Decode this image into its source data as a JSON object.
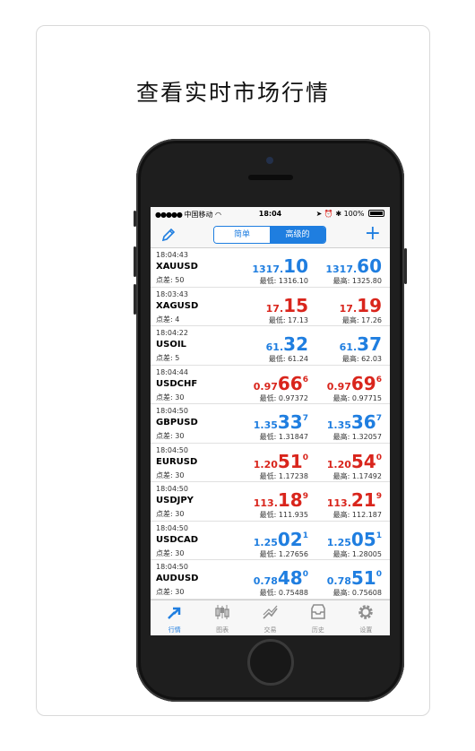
{
  "headline": "查看实时市场行情",
  "status": {
    "carrier": "中国移动",
    "time": "18:04",
    "battery": "100%"
  },
  "nav": {
    "seg_simple": "简单",
    "seg_advanced": "高级的"
  },
  "quotes": [
    {
      "time": "18:04:43",
      "symbol": "XAUUSD",
      "spread": "点差: 50",
      "color": "blue",
      "bid": {
        "small": "1317.",
        "big": "10",
        "sup": ""
      },
      "ask": {
        "small": "1317.",
        "big": "60",
        "sup": ""
      },
      "low": "最低: 1316.10",
      "high": "最高: 1325.80"
    },
    {
      "time": "18:03:43",
      "symbol": "XAGUSD",
      "spread": "点差: 4",
      "color": "red",
      "bid": {
        "small": "17.",
        "big": "15",
        "sup": ""
      },
      "ask": {
        "small": "17.",
        "big": "19",
        "sup": ""
      },
      "low": "最低: 17.13",
      "high": "最高: 17.26"
    },
    {
      "time": "18:04:22",
      "symbol": "USOIL",
      "spread": "点差: 5",
      "color": "blue",
      "bid": {
        "small": "61.",
        "big": "32",
        "sup": ""
      },
      "ask": {
        "small": "61.",
        "big": "37",
        "sup": ""
      },
      "low": "最低: 61.24",
      "high": "最高: 62.03"
    },
    {
      "time": "18:04:44",
      "symbol": "USDCHF",
      "spread": "点差: 30",
      "color": "red",
      "bid": {
        "small": "0.97",
        "big": "66",
        "sup": "6"
      },
      "ask": {
        "small": "0.97",
        "big": "69",
        "sup": "6"
      },
      "low": "最低: 0.97372",
      "high": "最高: 0.97715"
    },
    {
      "time": "18:04:50",
      "symbol": "GBPUSD",
      "spread": "点差: 30",
      "color": "blue",
      "bid": {
        "small": "1.35",
        "big": "33",
        "sup": "7"
      },
      "ask": {
        "small": "1.35",
        "big": "36",
        "sup": "7"
      },
      "low": "最低: 1.31847",
      "high": "最高: 1.32057"
    },
    {
      "time": "18:04:50",
      "symbol": "EURUSD",
      "spread": "点差: 30",
      "color": "red",
      "bid": {
        "small": "1.20",
        "big": "51",
        "sup": "0"
      },
      "ask": {
        "small": "1.20",
        "big": "54",
        "sup": "0"
      },
      "low": "最低: 1.17238",
      "high": "最高: 1.17492"
    },
    {
      "time": "18:04:50",
      "symbol": "USDJPY",
      "spread": "点差: 30",
      "color": "red",
      "bid": {
        "small": "113.",
        "big": "18",
        "sup": "9"
      },
      "ask": {
        "small": "113.",
        "big": "21",
        "sup": "9"
      },
      "low": "最低: 111.935",
      "high": "最高: 112.187"
    },
    {
      "time": "18:04:50",
      "symbol": "USDCAD",
      "spread": "点差: 30",
      "color": "blue",
      "bid": {
        "small": "1.25",
        "big": "02",
        "sup": "1"
      },
      "ask": {
        "small": "1.25",
        "big": "05",
        "sup": "1"
      },
      "low": "最低: 1.27656",
      "high": "最高: 1.28005"
    },
    {
      "time": "18:04:50",
      "symbol": "AUDUSD",
      "spread": "点差: 30",
      "color": "blue",
      "bid": {
        "small": "0.78",
        "big": "48",
        "sup": "0"
      },
      "ask": {
        "small": "0.78",
        "big": "51",
        "sup": "0"
      },
      "low": "最低: 0.75488",
      "high": "最高: 0.75608"
    }
  ],
  "tabs": [
    {
      "label": "行情",
      "icon": "quotes-icon",
      "active": true
    },
    {
      "label": "图表",
      "icon": "chart-icon",
      "active": false
    },
    {
      "label": "交易",
      "icon": "trade-icon",
      "active": false
    },
    {
      "label": "历史",
      "icon": "history-icon",
      "active": false
    },
    {
      "label": "设置",
      "icon": "settings-icon",
      "active": false
    }
  ],
  "colors": {
    "accent": "#1f7ee0",
    "down": "#d9251c"
  }
}
